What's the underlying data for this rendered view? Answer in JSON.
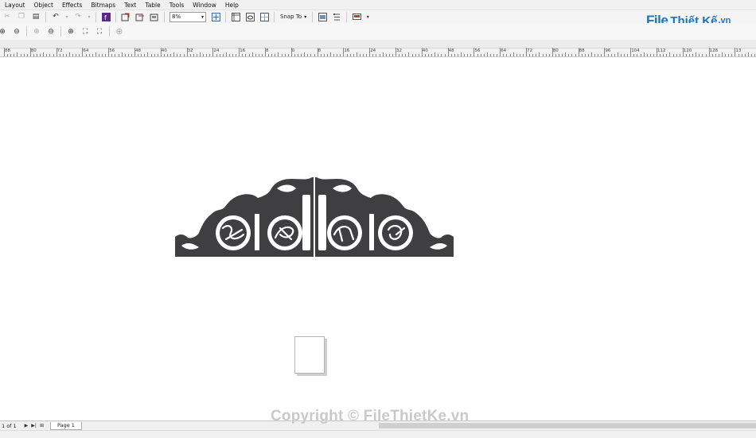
{
  "menu": [
    "Layout",
    "Object",
    "Effects",
    "Bitmaps",
    "Text",
    "Table",
    "Tools",
    "Window",
    "Help"
  ],
  "toolbar": {
    "zoom_value": "8%",
    "snap_label": "Snap To"
  },
  "ruler": {
    "labels": [
      "88",
      "80",
      "72",
      "64",
      "56",
      "48",
      "40",
      "32",
      "24",
      "16",
      "8",
      "0",
      "8",
      "16",
      "24",
      "32",
      "40",
      "48",
      "56",
      "64",
      "72",
      "80",
      "88",
      "96",
      "104",
      "112",
      "120",
      "128",
      "13"
    ]
  },
  "status": {
    "page_count": "1 of 1",
    "page_tab": "Page 1"
  },
  "logo": {
    "brand_prefix": "File",
    "brand_name": "Thiết Kế",
    "brand_suffix": ".vn"
  },
  "watermark": "Copyright © FileThietKe.vn",
  "colors": {
    "artwork": "#3f3f42",
    "logo": "#1e73be"
  }
}
